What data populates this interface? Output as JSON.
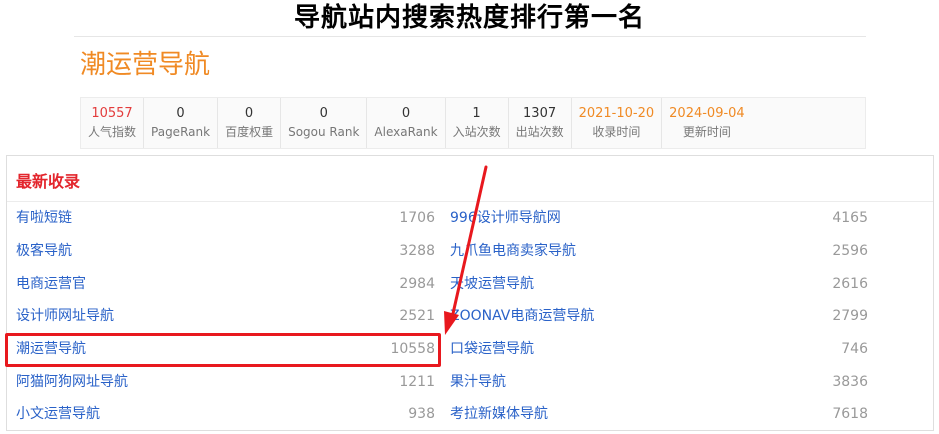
{
  "headline": "导航站内搜索热度排行第一名",
  "site": {
    "name": "潮运营导航",
    "stats": [
      {
        "value": "10557",
        "label": "人气指数",
        "tone": "red"
      },
      {
        "value": "0",
        "label": "PageRank",
        "tone": "plain"
      },
      {
        "value": "0",
        "label": "百度权重",
        "tone": "plain"
      },
      {
        "value": "0",
        "label": "Sogou Rank",
        "tone": "plain"
      },
      {
        "value": "0",
        "label": "AlexaRank",
        "tone": "plain"
      },
      {
        "value": "1",
        "label": "入站次数",
        "tone": "plain"
      },
      {
        "value": "1307",
        "label": "出站次数",
        "tone": "plain"
      },
      {
        "value": "2021-10-20",
        "label": "收录时间",
        "tone": "orange"
      },
      {
        "value": "2024-09-04",
        "label": "更新时间",
        "tone": "orange"
      }
    ]
  },
  "latest": {
    "title": "最新收录",
    "left": [
      {
        "name": "有啦短链",
        "count": "1706"
      },
      {
        "name": "极客导航",
        "count": "3288"
      },
      {
        "name": "电商运营官",
        "count": "2984"
      },
      {
        "name": "设计师网址导航",
        "count": "2521"
      },
      {
        "name": "潮运营导航",
        "count": "10558"
      },
      {
        "name": "阿猫阿狗网址导航",
        "count": "1211"
      },
      {
        "name": "小文运营导航",
        "count": "938"
      }
    ],
    "right": [
      {
        "name": "996设计师导航网",
        "count": "4165"
      },
      {
        "name": "九爪鱼电商卖家导航",
        "count": "2596"
      },
      {
        "name": "天坡运营导航",
        "count": "2616"
      },
      {
        "name": "ZOONAV电商运营导航",
        "count": "2799"
      },
      {
        "name": "口袋运营导航",
        "count": "746"
      },
      {
        "name": "果汁导航",
        "count": "3836"
      },
      {
        "name": "考拉新媒体导航",
        "count": "7618"
      }
    ]
  },
  "colors": {
    "accent": "#f08a24",
    "highlight": "#e8181e",
    "link": "#2a62c8"
  }
}
